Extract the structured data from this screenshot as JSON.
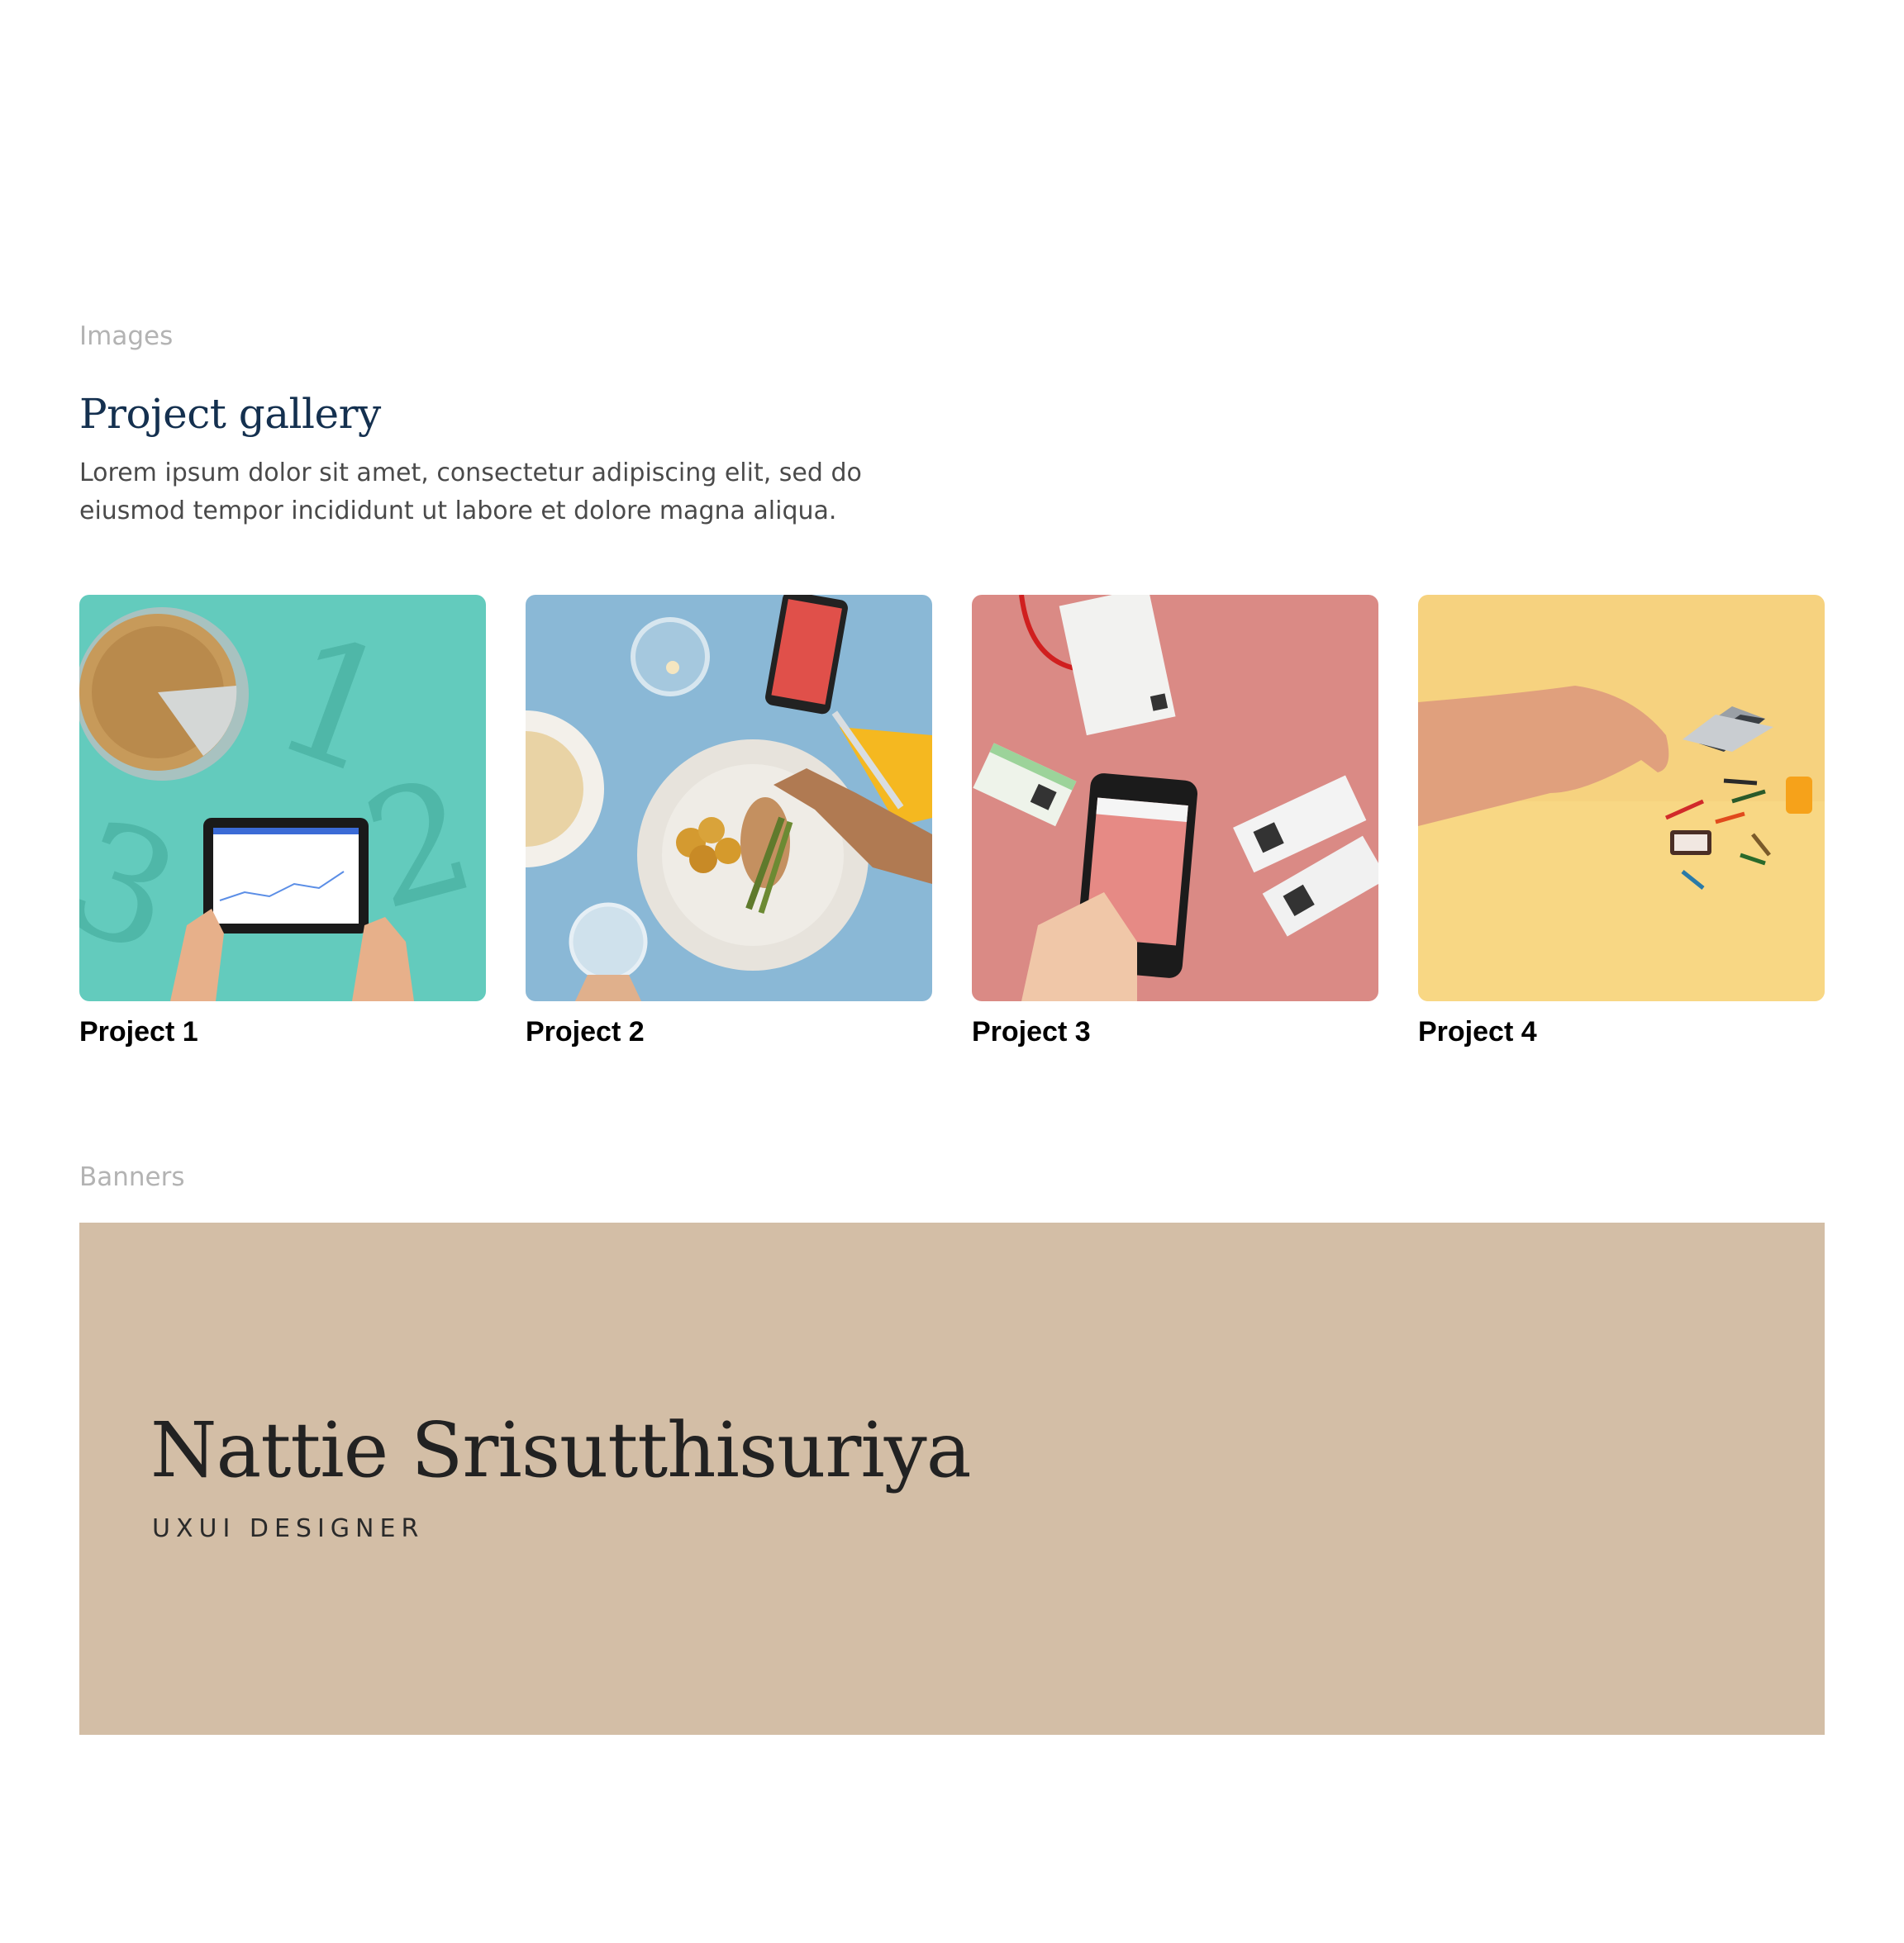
{
  "sections": {
    "images_label": "Images",
    "banners_label": "Banners"
  },
  "gallery": {
    "title": "Project gallery",
    "description": "Lorem ipsum dolor sit amet, consectetur adipiscing elit, sed do eiusmod tempor incididunt ut labore et dolore magna aliqua.",
    "projects": [
      {
        "title": "Project 1",
        "bg": "#63cbbd"
      },
      {
        "title": "Project 2",
        "bg": "#8ab8d6"
      },
      {
        "title": "Project 3",
        "bg": "#da8a85"
      },
      {
        "title": "Project 4",
        "bg": "#f6d27f"
      }
    ]
  },
  "banner": {
    "name": "Nattie Srisutthisuriya",
    "role": "UXUI DESIGNER",
    "bg": "#d3bea6"
  }
}
